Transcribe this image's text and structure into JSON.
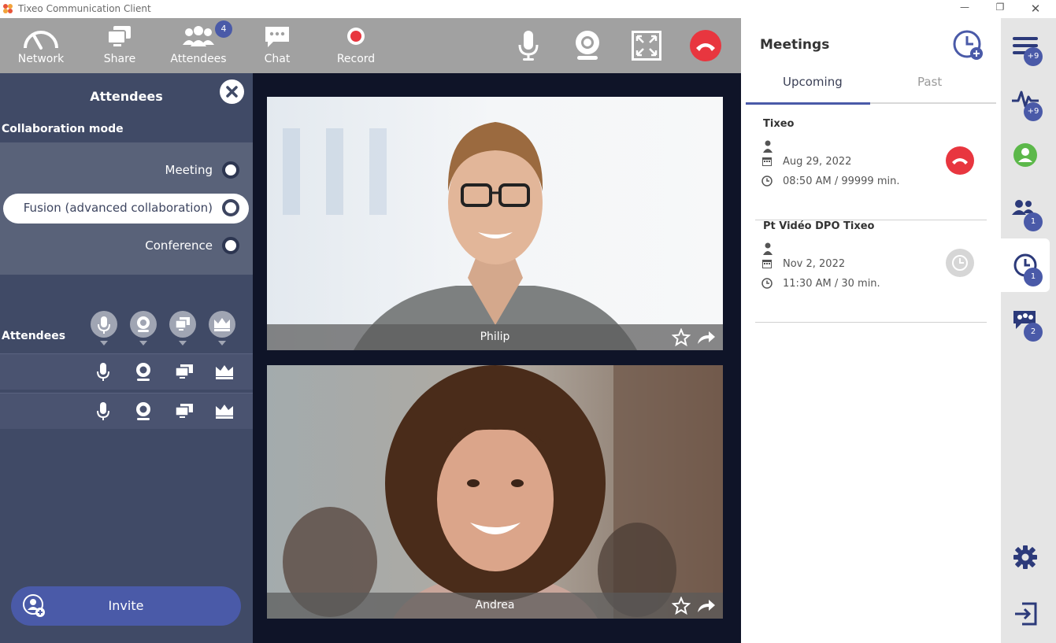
{
  "window": {
    "title": "Tixeo Communication Client"
  },
  "toolbar": {
    "network": "Network",
    "share": "Share",
    "attendees": "Attendees",
    "attendees_count": "4",
    "chat": "Chat",
    "record": "Record"
  },
  "attendees_panel": {
    "title": "Attendees",
    "collab_label": "Collaboration mode",
    "modes": [
      "Meeting",
      "Fusion (advanced collaboration)",
      "Conference"
    ],
    "selected_mode": "Fusion (advanced collaboration)",
    "list_label": "Attendees",
    "invite": "Invite"
  },
  "videos": [
    {
      "name": "Philip"
    },
    {
      "name": "Andrea"
    }
  ],
  "meetings": {
    "title": "Meetings",
    "tabs": [
      "Upcoming",
      "Past"
    ],
    "active_tab": "Upcoming",
    "items": [
      {
        "title": "Tixeo",
        "date": "Aug 29, 2022",
        "time": "08:50 AM / 99999 min.",
        "action": "hangup"
      },
      {
        "title": "Pt Vidéo DPO Tixeo",
        "date": "Nov 2, 2022",
        "time": "11:30 AM / 30 min.",
        "action": "scheduled"
      }
    ]
  },
  "rail": {
    "menu_badge": "+9",
    "activity_badge": "+9",
    "contacts_badge": "1",
    "meetings_badge": "1",
    "chat_badge": "2"
  },
  "colors": {
    "accent": "#4a5aa8",
    "hangup": "#e8363f",
    "panel": "#404a66",
    "toolbar": "#a1a1a1",
    "presence_green": "#5cb84a"
  }
}
